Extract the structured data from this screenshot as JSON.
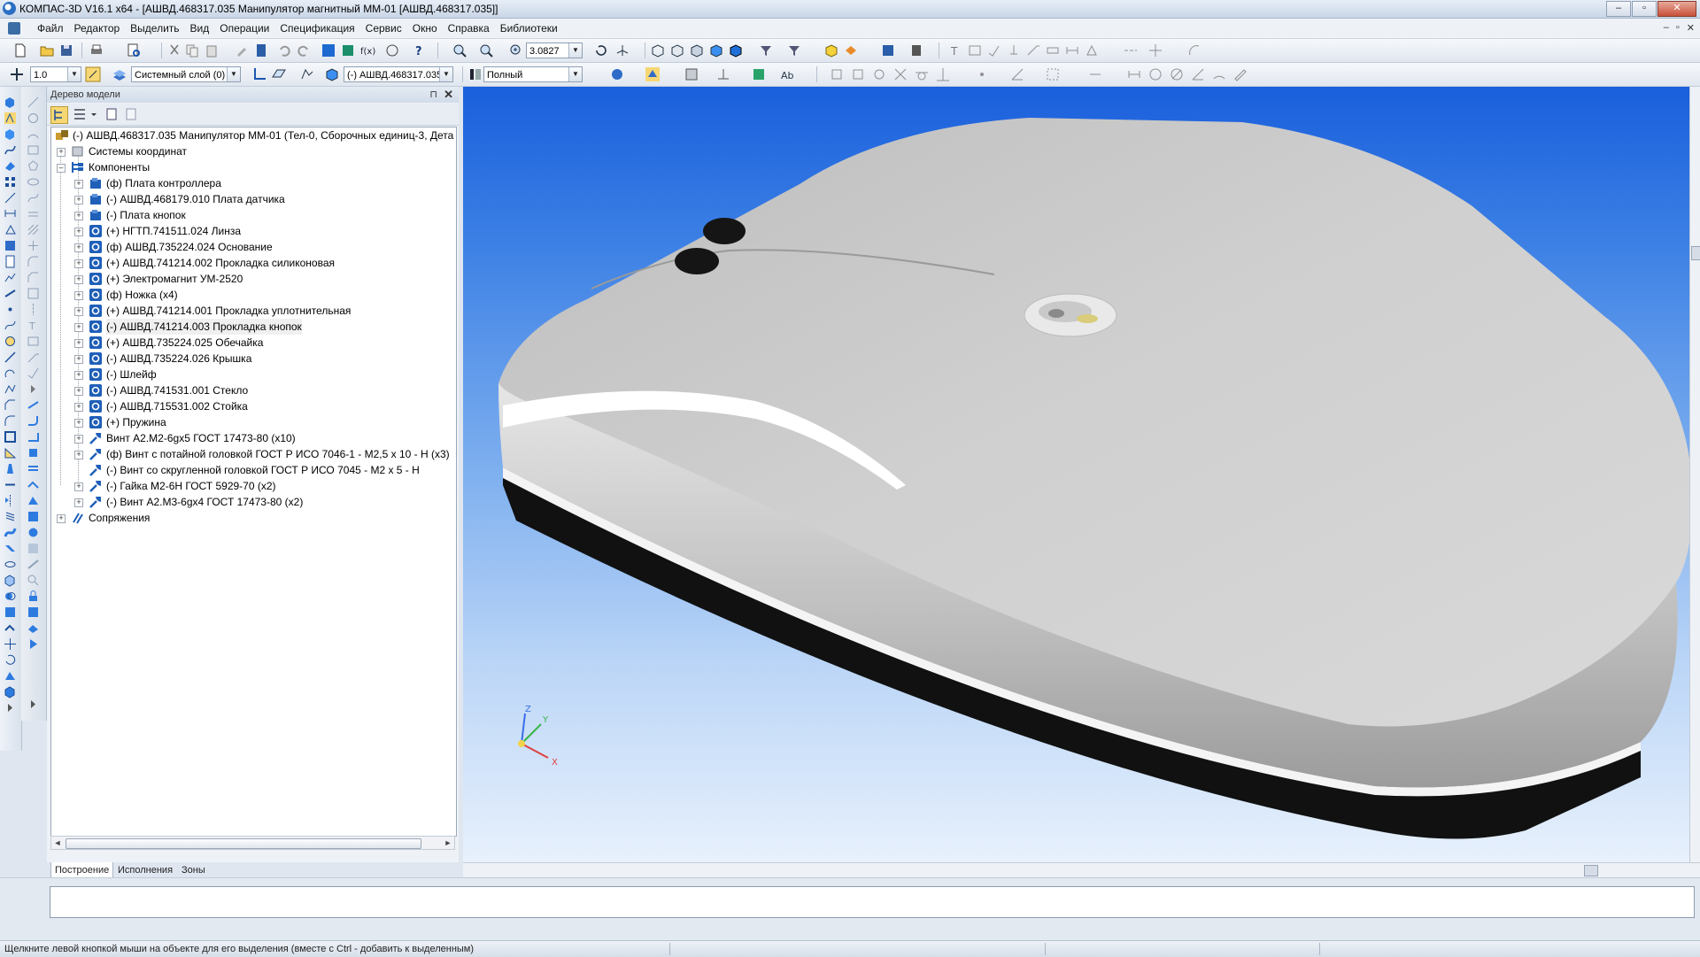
{
  "window": {
    "title": "КОМПАС-3D V16.1 x64 - [АШВД.468317.035 Манипулятор магнитный ММ-01 [АШВД.468317.035]]",
    "buttons": [
      "–",
      "▫",
      "✕"
    ]
  },
  "menu": {
    "items": [
      "Файл",
      "Редактор",
      "Выделить",
      "Вид",
      "Операции",
      "Спецификация",
      "Сервис",
      "Окно",
      "Справка",
      "Библиотеки"
    ],
    "mdi_buttons": [
      "–",
      "▫",
      "✕"
    ]
  },
  "toolbar": {
    "zoom_value": "3.0827",
    "step_value": "1.0",
    "layer_value": "Системный слой (0)",
    "part_value": "(-) АШВД.468317.035",
    "display_mode": "Полный"
  },
  "tree_panel": {
    "title": "Дерево модели",
    "pin": "⊓",
    "close": "✕",
    "root": "(-) АШВД.468317.035 Манипулятор ММ-01 (Тел-0, Сборочных единиц-3, Дета",
    "groups": {
      "coords": "Системы координат",
      "components": "Компоненты",
      "mates": "Сопряжения"
    },
    "items": [
      {
        "label": "(ф) Плата контроллера",
        "kind": "assembly"
      },
      {
        "label": "(-) АШВД.468179.010 Плата датчика",
        "kind": "assembly"
      },
      {
        "label": "(-) Плата кнопок",
        "kind": "assembly"
      },
      {
        "label": "(+) НГТП.741511.024 Линза",
        "kind": "part"
      },
      {
        "label": "(ф) АШВД.735224.024 Основание",
        "kind": "part"
      },
      {
        "label": "(+) АШВД.741214.002 Прокладка силиконовая",
        "kind": "part"
      },
      {
        "label": "(+) Электромагнит УМ-2520",
        "kind": "part"
      },
      {
        "label": "(ф) Ножка (x4)",
        "kind": "part"
      },
      {
        "label": "(+) АШВД.741214.001 Прокладка уплотнительная",
        "kind": "part"
      },
      {
        "label": "(-) АШВД.741214.003 Прокладка кнопок",
        "kind": "part",
        "selected": true
      },
      {
        "label": "(+) АШВД.735224.025 Обечайка",
        "kind": "part"
      },
      {
        "label": "(-) АШВД.735224.026 Крышка",
        "kind": "part"
      },
      {
        "label": "(-) Шлейф",
        "kind": "part"
      },
      {
        "label": "(-) АШВД.741531.001 Стекло",
        "kind": "part"
      },
      {
        "label": "(-) АШВД.715531.002 Стойка",
        "kind": "part"
      },
      {
        "label": "(+) Пружина",
        "kind": "part"
      },
      {
        "label": "Винт A2.M2-6gx5 ГОСТ 17473-80 (x10)",
        "kind": "std"
      },
      {
        "label": "(ф) Винт с потайной головкой ГОСТ Р ИСО 7046-1 - M2,5 x 10 - H (x3)",
        "kind": "std"
      },
      {
        "label": "(-) Винт со скругленной головкой ГОСТ Р ИСО 7045 - M2 x 5 - H",
        "kind": "std",
        "no_expander": true
      },
      {
        "label": "(-) Гайка М2-6Н ГОСТ 5929-70 (x2)",
        "kind": "std"
      },
      {
        "label": "(-) Винт A2.M3-6gx4 ГОСТ 17473-80 (x2)",
        "kind": "std"
      }
    ],
    "tabs": [
      "Построение",
      "Исполнения",
      "Зоны"
    ]
  },
  "viewport": {
    "axes": [
      "X",
      "Y",
      "Z"
    ]
  },
  "status": {
    "text": "Щелкните левой кнопкой мыши на объекте для его выделения (вместе с Ctrl - добавить к выделенным)"
  },
  "colors": {
    "view_top": "#1a5fdc",
    "view_bottom": "#e8f1fc",
    "model_body": "#c8c8c8",
    "model_base": "#111111",
    "tree_icon_blue": "#1f5fb8"
  }
}
